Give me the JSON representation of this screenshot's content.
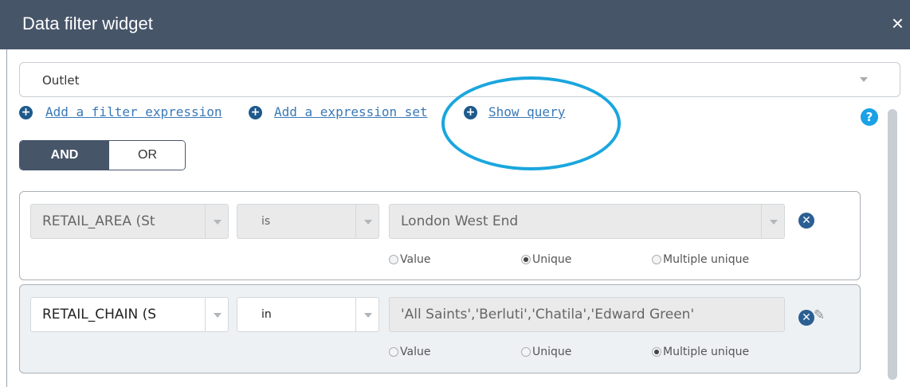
{
  "window": {
    "title": "Data filter widget",
    "close_label": "×"
  },
  "layer_select": {
    "value": "Outlet"
  },
  "links": {
    "add_filter_expression": "Add a filter expression",
    "add_expression_set": "Add a expression set",
    "show_query": "Show query",
    "plus_glyph": "+"
  },
  "help": {
    "glyph": "?"
  },
  "logic_toggle": {
    "and_label": "AND",
    "or_label": "OR",
    "selected": "AND"
  },
  "expressions": [
    {
      "field": "RETAIL_AREA (St",
      "operator": "is",
      "value": "London West End",
      "radio_labels": [
        "Value",
        "Unique",
        "Multiple unique"
      ],
      "selected_radio": "Unique",
      "remove_glyph": "✕"
    },
    {
      "field": "RETAIL_CHAIN (S",
      "operator": "in",
      "value": "'All Saints','Berluti','Chatila','Edward Green'",
      "radio_labels": [
        "Value",
        "Unique",
        "Multiple unique"
      ],
      "selected_radio": "Multiple unique",
      "remove_glyph": "✕",
      "edit_glyph": "✎"
    }
  ],
  "colors": {
    "titlebar": "#475569",
    "link": "#3a79b7",
    "annotation_circle": "#1aa6de",
    "help_icon": "#1aa1e6"
  }
}
